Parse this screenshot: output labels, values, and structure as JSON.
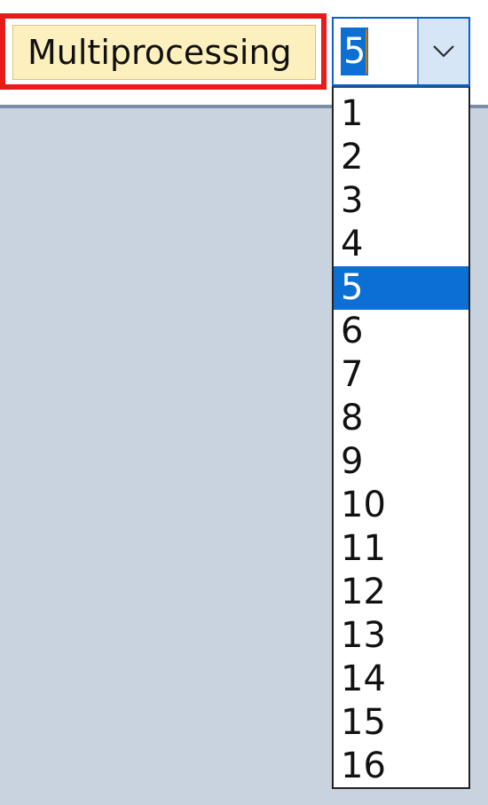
{
  "label": {
    "text": "Multiprocessing"
  },
  "combo": {
    "value": "5",
    "button_icon": "chevron-down-icon"
  },
  "dropdown": {
    "options": [
      "1",
      "2",
      "3",
      "4",
      "5",
      "6",
      "7",
      "8",
      "9",
      "10",
      "11",
      "12",
      "13",
      "14",
      "15",
      "16"
    ],
    "selected": "5"
  },
  "colors": {
    "highlight_border": "#e81b1b",
    "label_background": "#fdf0bf",
    "selection": "#0b6fd4",
    "panel": "#c9d3e0",
    "separator": "#7d8fa8"
  }
}
